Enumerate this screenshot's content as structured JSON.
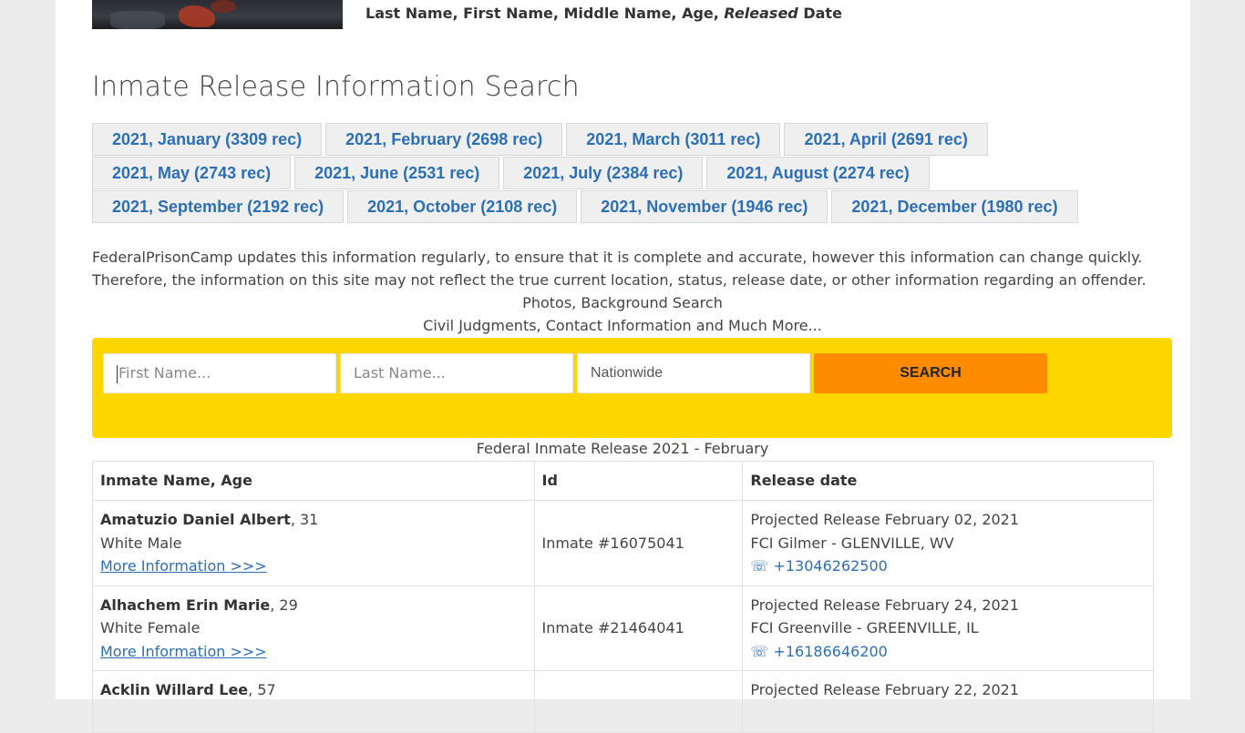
{
  "header": {
    "caption_parts": [
      "Last Name, First Name, Middle Name, Age, ",
      "Released",
      " Date"
    ]
  },
  "title": "Inmate Release Information Search",
  "months": [
    [
      "2021, January (3309 rec)",
      "2021, February (2698 rec)",
      "2021, March (3011 rec)",
      "2021, April (2691 rec)"
    ],
    [
      "2021, May (2743 rec)",
      "2021, June (2531 rec)",
      "2021, July (2384 rec)",
      "2021, August (2274 rec)"
    ],
    [
      "2021, September (2192 rec)",
      "2021, October (2108 rec)",
      "2021, November (1946 rec)",
      "2021, December (1980 rec)"
    ]
  ],
  "notice": {
    "line1": "FederalPrisonCamp updates this information regularly, to ensure that it is complete and accurate, however this information can change quickly.",
    "line2": "Therefore, the information on this site may not reflect the true current location, status, release date, or other information regarding an offender."
  },
  "promo": {
    "line1": "Photos, Background Search",
    "line2": "Civil Judgments, Contact Information and Much More..."
  },
  "search": {
    "first_placeholder": "First Name...",
    "last_placeholder": "Last Name...",
    "state_value": "Nationwide",
    "button_label": "SEARCH",
    "bar_color": "#fdd600",
    "button_color": "#ff8c00"
  },
  "table": {
    "caption": "Federal Inmate Release 2021 - February",
    "headers": [
      "Inmate Name, Age",
      "Id",
      "Release date"
    ],
    "rows": [
      {
        "name": "Amatuzio Daniel Albert",
        "age": ", 31",
        "race_sex": "White Male",
        "link": "More Information >>>",
        "id": "Inmate #16075041",
        "release": "Projected Release February 02, 2021",
        "facility": "FCI Gilmer - GLENVILLE, WV",
        "phone": "☏ +13046262500"
      },
      {
        "name": "Alhachem Erin Marie",
        "age": ", 29",
        "race_sex": "White Female",
        "link": "More Information >>>",
        "id": "Inmate #21464041",
        "release": "Projected Release February 24, 2021",
        "facility": "FCI Greenville - GREENVILLE, IL",
        "phone": "☏ +16186646200"
      },
      {
        "name": "Acklin Willard Lee",
        "age": ", 57",
        "race_sex": "",
        "link": "",
        "id": "",
        "release": "Projected Release February 22, 2021",
        "facility": "",
        "phone": ""
      }
    ]
  }
}
